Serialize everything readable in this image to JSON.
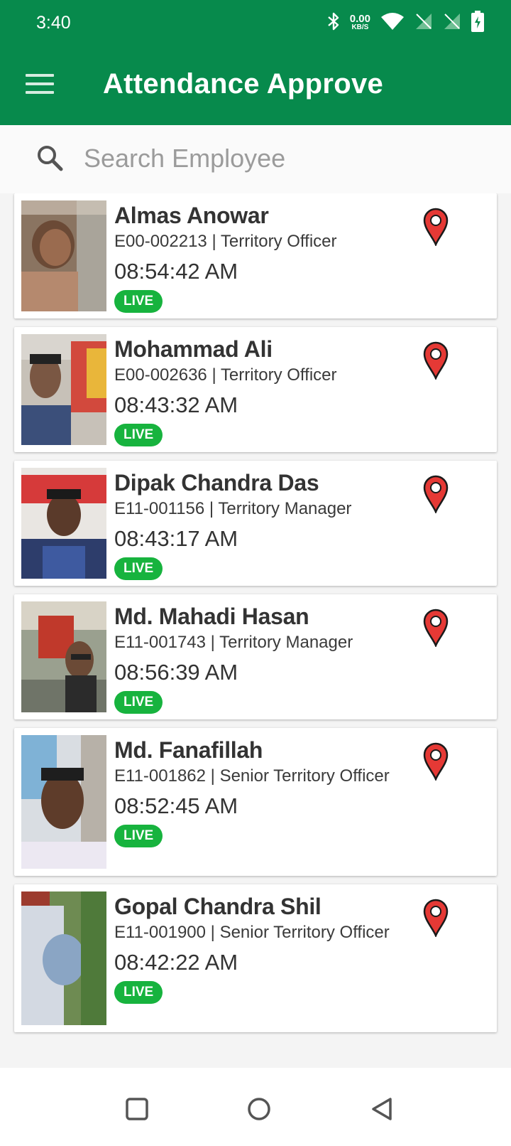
{
  "status_bar": {
    "time": "3:40",
    "net_speed_value": "0.00",
    "net_speed_unit": "KB/S",
    "icons": [
      "bluetooth-icon",
      "wifi-icon",
      "no-sim-icon",
      "no-sim-icon",
      "battery-charging-icon"
    ]
  },
  "toolbar": {
    "title": "Attendance Approve",
    "menu_icon": "hamburger-menu-icon"
  },
  "search": {
    "placeholder": "Search Employee",
    "value": ""
  },
  "colors": {
    "primary": "#078a4c",
    "live_badge": "#17b33e",
    "pin": "#e53935"
  },
  "employees": [
    {
      "name": "Almas Anowar",
      "meta": "E00-002213 | Territory Officer",
      "time": "08:54:42 AM",
      "badge": "LIVE"
    },
    {
      "name": "Mohammad Ali",
      "meta": "E00-002636 | Territory Officer",
      "time": "08:43:32 AM",
      "badge": "LIVE"
    },
    {
      "name": "Dipak Chandra Das",
      "meta": "E11-001156 | Territory Manager",
      "time": "08:43:17 AM",
      "badge": "LIVE"
    },
    {
      "name": "Md. Mahadi Hasan",
      "meta": "E11-001743 | Territory Manager",
      "time": "08:56:39 AM",
      "badge": "LIVE"
    },
    {
      "name": "Md. Fanafillah",
      "meta": "E11-001862 | Senior Territory Officer",
      "time": "08:52:45 AM",
      "badge": "LIVE"
    },
    {
      "name": "Gopal Chandra Shil",
      "meta": "E11-001900 | Senior Territory Officer",
      "time": "08:42:22 AM",
      "badge": "LIVE"
    }
  ],
  "nav_bar": {
    "icons": [
      "recents-square-icon",
      "home-circle-icon",
      "back-triangle-icon"
    ]
  }
}
